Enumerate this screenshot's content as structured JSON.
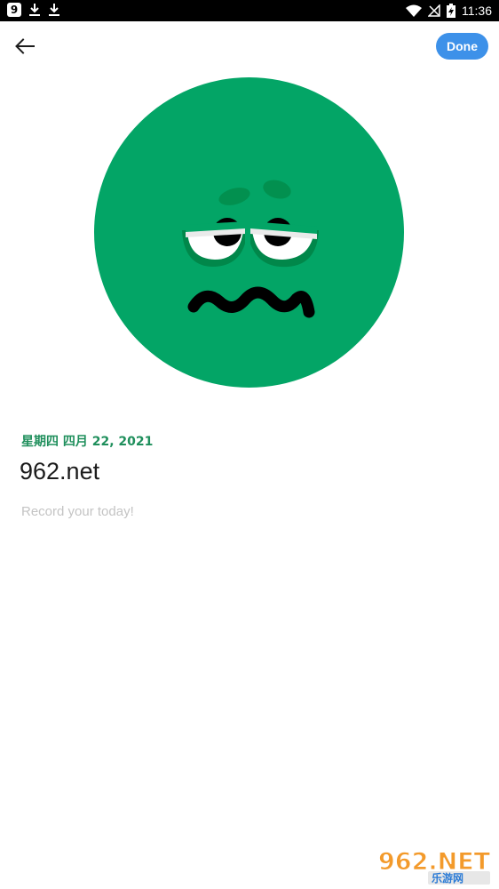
{
  "status_bar": {
    "app_badge": "9",
    "time": "11:36",
    "icons": [
      "app-badge-icon",
      "download-icon",
      "download-icon",
      "wifi-icon",
      "no-signal-icon",
      "battery-charging-icon"
    ]
  },
  "top_bar": {
    "back_icon": "arrow-left-icon",
    "done_label": "Done",
    "accent_color": "#3d91e9"
  },
  "mood": {
    "icon": "worried-face-icon",
    "color": "#03a566"
  },
  "entry": {
    "date": "星期四 四月 22, 2021",
    "title": "962.net",
    "placeholder": "Record your today!",
    "date_color": "#1f8f5c"
  },
  "watermark": {
    "main": "962.NET",
    "sub": "乐游网"
  }
}
